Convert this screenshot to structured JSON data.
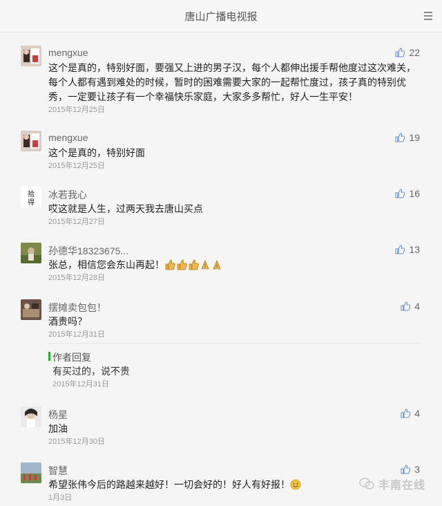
{
  "header": {
    "title": "唐山广播电视报",
    "menu_icon": "menu-icon"
  },
  "comments": [
    {
      "nick": "mengxue",
      "text": "这个是真的，特别好面，要强又上进的男子汉，每个人都伸出援手帮他度过这次难关，每个人都有遇到难处的时候，暂时的困难需要大家的一起帮忙度过，孩子真的特别优秀，一定要让孩子有一个幸福快乐家庭，大家多多帮忙，好人一生平安！",
      "date": "2015年12月25日",
      "likes": "22"
    },
    {
      "nick": "mengxue",
      "text": "这个是真的，特别好面",
      "date": "2015年12月25日",
      "likes": "19"
    },
    {
      "nick": "冰若我心",
      "text": "哎这就是人生，过两天我去唐山买点",
      "date": "2015年12月27日",
      "likes": "16"
    },
    {
      "nick": "孙德华18323675...",
      "text": "张总，相信您会东山再起！",
      "date": "2015年12月28日",
      "likes": "13"
    },
    {
      "nick": "摆摊卖包包！",
      "text": "酒贵吗？",
      "date": "2015年12月31日",
      "likes": "4",
      "reply": {
        "label": "作者回复",
        "text": "有买过的，说不贵",
        "date": "2015年12月31日"
      }
    },
    {
      "nick": "杨星",
      "text": "加油",
      "date": "2015年12月30日",
      "likes": "4"
    },
    {
      "nick": "智慧",
      "text": "希望张伟今后的路越来越好！一切会好的！好人有好报！",
      "date": "1月3日",
      "likes": "3"
    }
  ],
  "watermark": {
    "text": "丰南在线"
  },
  "colors": {
    "reply_bar": "#2bb12b",
    "muted": "#999999"
  }
}
